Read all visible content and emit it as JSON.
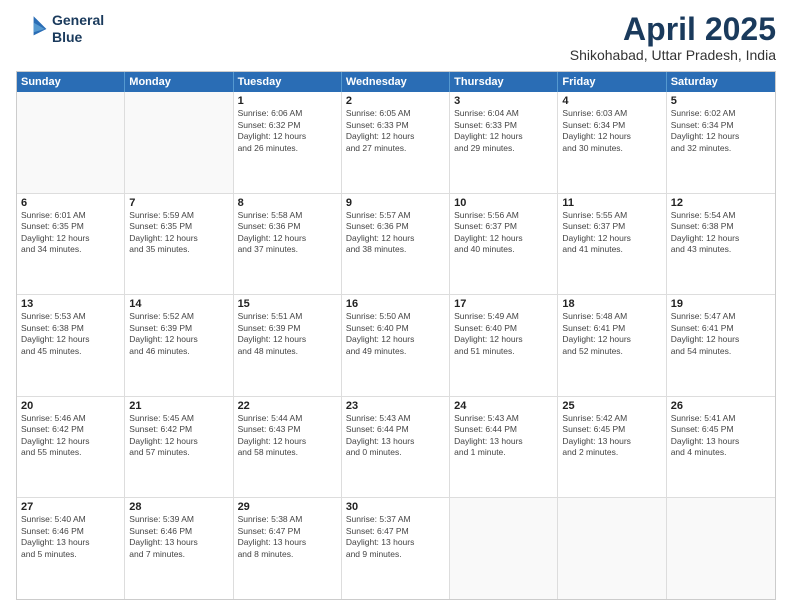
{
  "header": {
    "logo_line1": "General",
    "logo_line2": "Blue",
    "month_title": "April 2025",
    "location": "Shikohabad, Uttar Pradesh, India"
  },
  "day_headers": [
    "Sunday",
    "Monday",
    "Tuesday",
    "Wednesday",
    "Thursday",
    "Friday",
    "Saturday"
  ],
  "weeks": [
    [
      {
        "date": "",
        "info": ""
      },
      {
        "date": "",
        "info": ""
      },
      {
        "date": "1",
        "info": "Sunrise: 6:06 AM\nSunset: 6:32 PM\nDaylight: 12 hours\nand 26 minutes."
      },
      {
        "date": "2",
        "info": "Sunrise: 6:05 AM\nSunset: 6:33 PM\nDaylight: 12 hours\nand 27 minutes."
      },
      {
        "date": "3",
        "info": "Sunrise: 6:04 AM\nSunset: 6:33 PM\nDaylight: 12 hours\nand 29 minutes."
      },
      {
        "date": "4",
        "info": "Sunrise: 6:03 AM\nSunset: 6:34 PM\nDaylight: 12 hours\nand 30 minutes."
      },
      {
        "date": "5",
        "info": "Sunrise: 6:02 AM\nSunset: 6:34 PM\nDaylight: 12 hours\nand 32 minutes."
      }
    ],
    [
      {
        "date": "6",
        "info": "Sunrise: 6:01 AM\nSunset: 6:35 PM\nDaylight: 12 hours\nand 34 minutes."
      },
      {
        "date": "7",
        "info": "Sunrise: 5:59 AM\nSunset: 6:35 PM\nDaylight: 12 hours\nand 35 minutes."
      },
      {
        "date": "8",
        "info": "Sunrise: 5:58 AM\nSunset: 6:36 PM\nDaylight: 12 hours\nand 37 minutes."
      },
      {
        "date": "9",
        "info": "Sunrise: 5:57 AM\nSunset: 6:36 PM\nDaylight: 12 hours\nand 38 minutes."
      },
      {
        "date": "10",
        "info": "Sunrise: 5:56 AM\nSunset: 6:37 PM\nDaylight: 12 hours\nand 40 minutes."
      },
      {
        "date": "11",
        "info": "Sunrise: 5:55 AM\nSunset: 6:37 PM\nDaylight: 12 hours\nand 41 minutes."
      },
      {
        "date": "12",
        "info": "Sunrise: 5:54 AM\nSunset: 6:38 PM\nDaylight: 12 hours\nand 43 minutes."
      }
    ],
    [
      {
        "date": "13",
        "info": "Sunrise: 5:53 AM\nSunset: 6:38 PM\nDaylight: 12 hours\nand 45 minutes."
      },
      {
        "date": "14",
        "info": "Sunrise: 5:52 AM\nSunset: 6:39 PM\nDaylight: 12 hours\nand 46 minutes."
      },
      {
        "date": "15",
        "info": "Sunrise: 5:51 AM\nSunset: 6:39 PM\nDaylight: 12 hours\nand 48 minutes."
      },
      {
        "date": "16",
        "info": "Sunrise: 5:50 AM\nSunset: 6:40 PM\nDaylight: 12 hours\nand 49 minutes."
      },
      {
        "date": "17",
        "info": "Sunrise: 5:49 AM\nSunset: 6:40 PM\nDaylight: 12 hours\nand 51 minutes."
      },
      {
        "date": "18",
        "info": "Sunrise: 5:48 AM\nSunset: 6:41 PM\nDaylight: 12 hours\nand 52 minutes."
      },
      {
        "date": "19",
        "info": "Sunrise: 5:47 AM\nSunset: 6:41 PM\nDaylight: 12 hours\nand 54 minutes."
      }
    ],
    [
      {
        "date": "20",
        "info": "Sunrise: 5:46 AM\nSunset: 6:42 PM\nDaylight: 12 hours\nand 55 minutes."
      },
      {
        "date": "21",
        "info": "Sunrise: 5:45 AM\nSunset: 6:42 PM\nDaylight: 12 hours\nand 57 minutes."
      },
      {
        "date": "22",
        "info": "Sunrise: 5:44 AM\nSunset: 6:43 PM\nDaylight: 12 hours\nand 58 minutes."
      },
      {
        "date": "23",
        "info": "Sunrise: 5:43 AM\nSunset: 6:44 PM\nDaylight: 13 hours\nand 0 minutes."
      },
      {
        "date": "24",
        "info": "Sunrise: 5:43 AM\nSunset: 6:44 PM\nDaylight: 13 hours\nand 1 minute."
      },
      {
        "date": "25",
        "info": "Sunrise: 5:42 AM\nSunset: 6:45 PM\nDaylight: 13 hours\nand 2 minutes."
      },
      {
        "date": "26",
        "info": "Sunrise: 5:41 AM\nSunset: 6:45 PM\nDaylight: 13 hours\nand 4 minutes."
      }
    ],
    [
      {
        "date": "27",
        "info": "Sunrise: 5:40 AM\nSunset: 6:46 PM\nDaylight: 13 hours\nand 5 minutes."
      },
      {
        "date": "28",
        "info": "Sunrise: 5:39 AM\nSunset: 6:46 PM\nDaylight: 13 hours\nand 7 minutes."
      },
      {
        "date": "29",
        "info": "Sunrise: 5:38 AM\nSunset: 6:47 PM\nDaylight: 13 hours\nand 8 minutes."
      },
      {
        "date": "30",
        "info": "Sunrise: 5:37 AM\nSunset: 6:47 PM\nDaylight: 13 hours\nand 9 minutes."
      },
      {
        "date": "",
        "info": ""
      },
      {
        "date": "",
        "info": ""
      },
      {
        "date": "",
        "info": ""
      }
    ]
  ]
}
